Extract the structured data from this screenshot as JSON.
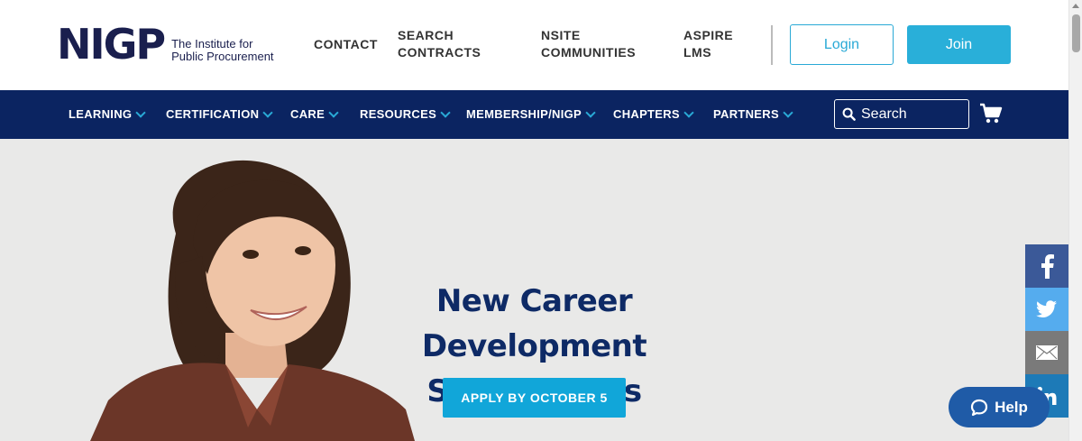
{
  "logo": {
    "mark": "NIGP",
    "tagline_line1": "The Institute for",
    "tagline_line2": "Public Procurement"
  },
  "top_links": [
    {
      "line1": "CONTACT",
      "line2": ""
    },
    {
      "line1": "SEARCH",
      "line2": "CONTRACTS"
    },
    {
      "line1": "NSITE",
      "line2": "COMMUNITIES"
    },
    {
      "line1": "ASPIRE",
      "line2": "LMS"
    }
  ],
  "auth": {
    "login_label": "Login",
    "join_label": "Join"
  },
  "nav": {
    "items": [
      "LEARNING",
      "CERTIFICATION",
      "CARE",
      "RESOURCES",
      "MEMBERSHIP/NIGP",
      "CHAPTERS",
      "PARTNERS"
    ],
    "search_placeholder": "Search"
  },
  "hero": {
    "title_line1": "New Career",
    "title_line2": "Development Scholarships",
    "cta_label": "APPLY BY OCTOBER 5"
  },
  "social": [
    "facebook-icon",
    "twitter-icon",
    "email-icon",
    "linkedin-icon"
  ],
  "help": {
    "label": "Help"
  },
  "colors": {
    "brand_navy": "#0b2461",
    "accent_blue": "#29a9d6",
    "hero_bg": "#e9e9e8",
    "title_blue": "#0e2a66",
    "facebook": "#3b5998",
    "twitter": "#55acee",
    "email": "#7a7a7a",
    "linkedin": "#1d7ab7",
    "help_blue": "#1f5ba7"
  }
}
